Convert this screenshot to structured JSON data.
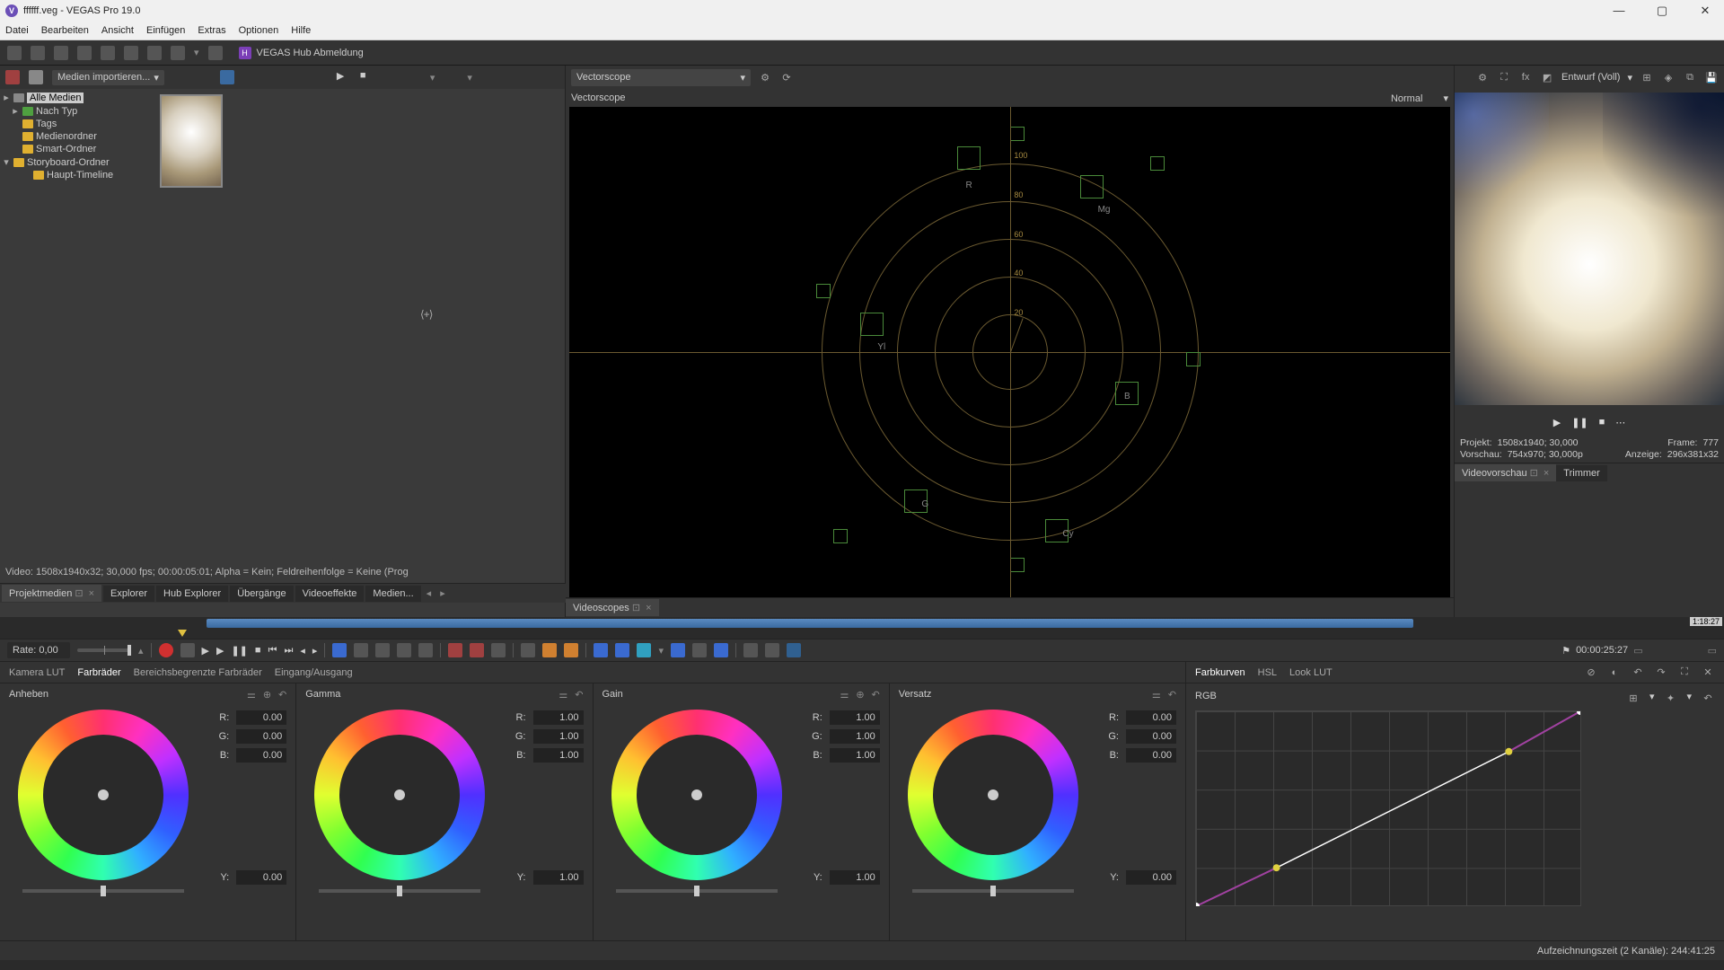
{
  "window": {
    "title": "ffffff.veg - VEGAS Pro 19.0",
    "app_letter": "V"
  },
  "menu": [
    "Datei",
    "Bearbeiten",
    "Ansicht",
    "Einfügen",
    "Extras",
    "Optionen",
    "Hilfe"
  ],
  "hub": {
    "letter": "H",
    "label": "VEGAS Hub Abmeldung"
  },
  "media_import_label": "Medien importieren...",
  "tree": {
    "root": "Alle Medien",
    "items": [
      "Nach Typ",
      "Tags",
      "Medienordner",
      "Smart-Ordner",
      "Storyboard-Ordner"
    ],
    "child": "Haupt-Timeline"
  },
  "video_info": "Video: 1508x1940x32; 30,000 fps; 00:00:05:01; Alpha = Kein; Feldreihenfolge = Keine (Prog",
  "tabs_left": [
    {
      "label": "Projektmedien",
      "pin": true,
      "close": true,
      "active": true
    },
    {
      "label": "Explorer"
    },
    {
      "label": "Hub Explorer"
    },
    {
      "label": "Übergänge"
    },
    {
      "label": "Videoeffekte"
    },
    {
      "label": "Medien..."
    }
  ],
  "scope": {
    "selector": "Vectorscope",
    "title": "Vectorscope",
    "mode": "Normal",
    "rings": [
      "20",
      "40",
      "60",
      "80",
      "100"
    ],
    "targets": [
      "R",
      "Mg",
      "B",
      "Cy",
      "G",
      "Yl"
    ]
  },
  "tabs_scope": {
    "label": "Videoscopes"
  },
  "timecode_mark": "1:18:27",
  "preview": {
    "quality": "Entwurf (Voll)",
    "projekt_label": "Projekt:",
    "projekt_val": "1508x1940; 30,000",
    "frame_label": "Frame:",
    "frame_val": "777",
    "vorschau_label": "Vorschau:",
    "vorschau_val": "754x970; 30,000p",
    "anzeige_label": "Anzeige:",
    "anzeige_val": "296x381x32"
  },
  "tabs_preview": [
    {
      "label": "Videovorschau",
      "pin": true,
      "close": true
    },
    {
      "label": "Trimmer"
    }
  ],
  "timeline": {
    "rate": "Rate: 0,00",
    "timecode": "00:00:25:27"
  },
  "cg_tabs_left": [
    "Kamera LUT",
    "Farbräder",
    "Bereichsbegrenzte Farbräder",
    "Eingang/Ausgang"
  ],
  "cg_tabs_right": [
    "Farbkurven",
    "HSL",
    "Look LUT"
  ],
  "wheels": [
    {
      "name": "Anheben",
      "r": "0.00",
      "g": "0.00",
      "b": "0.00",
      "y": "0.00"
    },
    {
      "name": "Gamma",
      "r": "1.00",
      "g": "1.00",
      "b": "1.00",
      "y": "1.00"
    },
    {
      "name": "Gain",
      "r": "1.00",
      "g": "1.00",
      "b": "1.00",
      "y": "1.00"
    },
    {
      "name": "Versatz",
      "r": "0.00",
      "g": "0.00",
      "b": "0.00",
      "y": "0.00"
    }
  ],
  "curves": {
    "mode": "RGB"
  },
  "status": "Aufzeichnungszeit (2 Kanäle): 244:41:25"
}
